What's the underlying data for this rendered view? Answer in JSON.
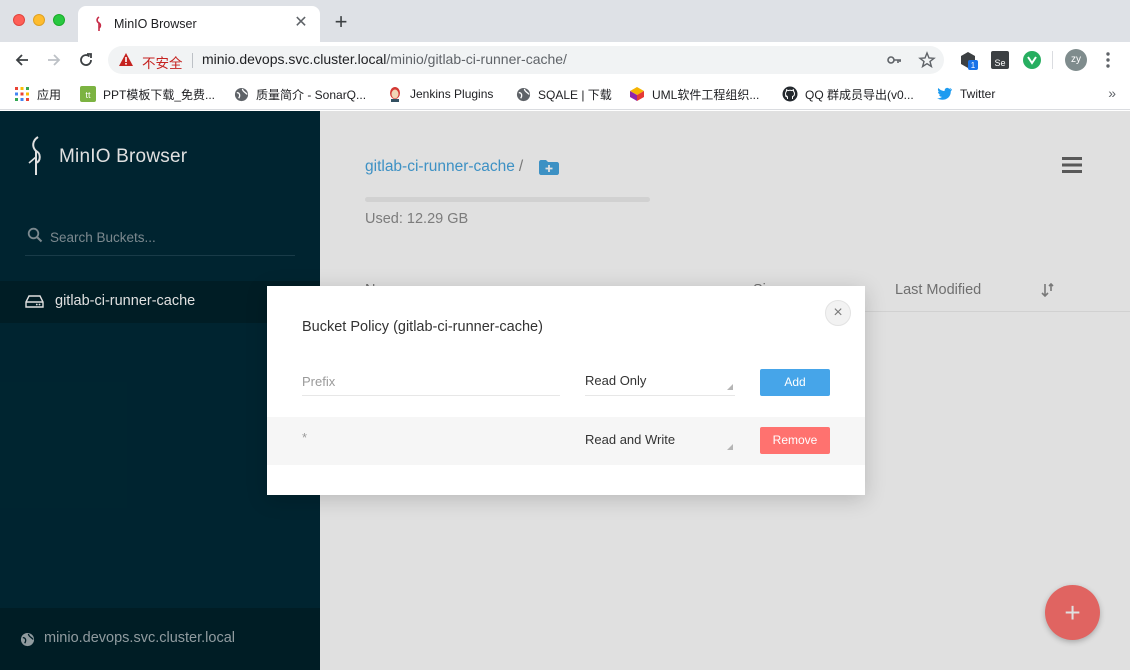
{
  "browser": {
    "tab_title": "MinIO Browser",
    "tab_close": "✕",
    "new_tab": "+",
    "security_label": "不安全",
    "url_host": "minio.devops.svc.cluster.local",
    "url_path": "/minio/gitlab-ci-runner-cache/",
    "profile_initials": "zy",
    "extension_badge": "1",
    "bookmarks_more": "»",
    "bookmarks": [
      {
        "label": "应用",
        "icon": "apps-grid-icon"
      },
      {
        "label": "PPT模板下载_免费...",
        "icon": "ppt-site-icon"
      },
      {
        "label": "质量简介 - SonarQ...",
        "icon": "globe-icon"
      },
      {
        "label": "Jenkins Plugins",
        "icon": "jenkins-icon"
      },
      {
        "label": "SQALE | 下载",
        "icon": "globe-icon"
      },
      {
        "label": "UML软件工程组织...",
        "icon": "uml-cube-icon"
      },
      {
        "label": "QQ 群成员导出(v0...",
        "icon": "github-icon"
      },
      {
        "label": "Twitter",
        "icon": "twitter-icon"
      }
    ]
  },
  "sidebar": {
    "brand": "MinIO Browser",
    "search_placeholder": "Search Buckets...",
    "buckets": [
      {
        "label": "gitlab-ci-runner-cache",
        "selected": true
      }
    ],
    "host": "minio.devops.svc.cluster.local"
  },
  "main": {
    "breadcrumb": "gitlab-ci-runner-cache",
    "breadcrumb_sep": "/",
    "usage_text": "Used: 12.29 GB",
    "usage_fraction": 0.0,
    "columns": {
      "name": "Name",
      "size": "Size",
      "modified": "Last Modified"
    },
    "fab_label": "+"
  },
  "modal": {
    "title": "Bucket Policy (gitlab-ci-runner-cache)",
    "close": "×",
    "new_policy": {
      "prefix_placeholder": "Prefix",
      "permission": "Read Only",
      "add_label": "Add"
    },
    "policies": [
      {
        "prefix": "*",
        "permission": "Read and Write",
        "remove_label": "Remove"
      }
    ]
  },
  "colors": {
    "sidebar": "#002a37",
    "accent": "#46a5e9",
    "danger": "#ff726f"
  }
}
